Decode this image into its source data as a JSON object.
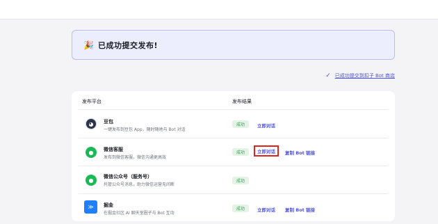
{
  "banner": {
    "icon": "party-popper-icon",
    "title": "已成功提交发布!"
  },
  "store_link": {
    "icon": "check-icon",
    "label": "已成功提交到扣子 Bot 商店"
  },
  "table": {
    "col_platform": "发布平台",
    "col_result": "发布结果",
    "rows": [
      {
        "icon": "doubao-avatar-icon",
        "name": "豆包",
        "desc": "一键发布到豆包 App，随时随地与 Bot 对话",
        "status": "成功",
        "chat": "立即对话",
        "link": ""
      },
      {
        "icon": "wechat-customer-service-icon",
        "name": "微信客服",
        "desc": "发布到微信客服，微信沟通更高效",
        "status": "成功",
        "chat": "立即对话",
        "link": "复制 Bot 链接"
      },
      {
        "icon": "wechat-official-account-icon",
        "name": "微信公众号（服务号）",
        "desc": "托管公众号消息，助力微信运营无间断",
        "status": "成功",
        "chat": "",
        "link": ""
      },
      {
        "icon": "juejin-icon",
        "name": "掘金",
        "desc": "在掘金社区 AI 聊天室圈子与 Bot 互动",
        "status": "成功",
        "chat": "立即对话",
        "link": "复制 Bot 链接"
      }
    ]
  },
  "colors": {
    "accent": "#4d53e8",
    "success": "#32a250",
    "highlight": "#e0241b"
  }
}
